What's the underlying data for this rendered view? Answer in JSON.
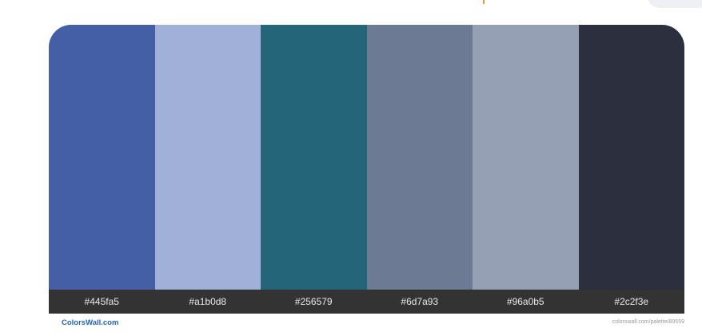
{
  "palette": {
    "colors": [
      "#445fa5",
      "#a1b0d8",
      "#256579",
      "#6d7a93",
      "#96a0b5",
      "#2c2f3e"
    ],
    "labels": [
      "#445fa5",
      "#a1b0d8",
      "#256579",
      "#6d7a93",
      "#96a0b5",
      "#2c2f3e"
    ]
  },
  "footer": {
    "brand": "ColorsWall.com",
    "url": "colorswall.com/palette/89559"
  },
  "accents": {
    "top_caret_color": "#d79b3a"
  }
}
